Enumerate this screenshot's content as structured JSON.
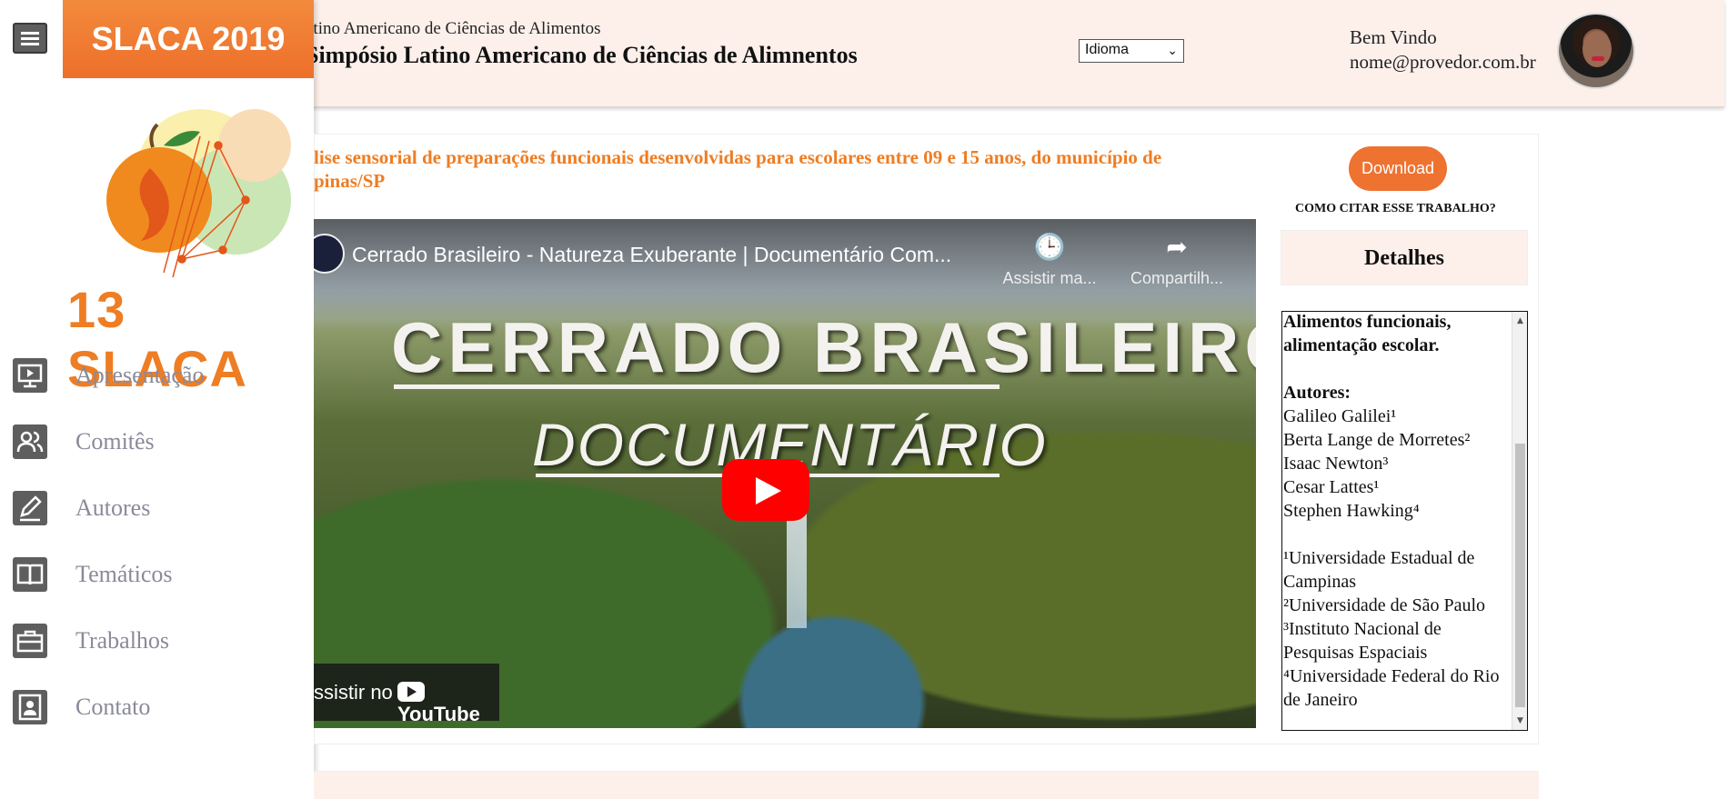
{
  "header": {
    "subtitle": "atino Americano de Ciências de Alimentos",
    "title": "Simpósio Latino Americano de Ciências de Alimnentos",
    "language_select": "Idioma",
    "welcome": "Bem Vindo",
    "email": "nome@provedor.com.br"
  },
  "sidebar": {
    "brand": "SLACA 2019",
    "logo_text": "13 SLACA",
    "items": [
      {
        "label": "Apresentação",
        "icon": "presentation-icon"
      },
      {
        "label": "Comitês",
        "icon": "people-icon"
      },
      {
        "label": "Autores",
        "icon": "pencil-icon"
      },
      {
        "label": "Temáticos",
        "icon": "book-icon"
      },
      {
        "label": "Trabalhos",
        "icon": "briefcase-icon"
      },
      {
        "label": "Contato",
        "icon": "contact-card-icon"
      }
    ]
  },
  "main": {
    "work_title": "lise sensorial de preparações funcionais desenvolvidas para escolares entre 09 e 15 anos, do município de\npinas/SP",
    "video": {
      "title": "Cerrado Brasileiro - Natureza Exuberante | Documentário Com...",
      "watch_later": "Assistir ma...",
      "share": "Compartilh...",
      "overlay_line1": "CERRADO BRASILEIRO",
      "overlay_line2": "DOCUMENTÁRIO",
      "watch_on": "ssistir no",
      "youtube": "YouTube"
    }
  },
  "aside": {
    "download": "Download",
    "cite": "COMO CITAR ESSE TRABALHO?",
    "details": "Detalhes",
    "keywords_1": "Alimentos funcionais,",
    "keywords_2": "alimentação escolar.",
    "authors_heading": "Autores:",
    "authors": [
      "Galileo Galilei¹",
      "Berta Lange de Morretes²",
      "Isaac Newton³",
      "Cesar Lattes¹",
      "Stephen Hawking⁴"
    ],
    "affiliations": [
      "¹Universidade Estadual de Campinas",
      "²Universidade de São Paulo",
      "³Instituto Nacional de Pesquisas Espaciais",
      "⁴Universidade Federal do Rio de Janeiro"
    ]
  },
  "colors": {
    "accent": "#ee7d23",
    "header_bg": "#fdf0eb",
    "icon_bg": "#5e5e5e",
    "nav_text": "#8a8a9a"
  }
}
